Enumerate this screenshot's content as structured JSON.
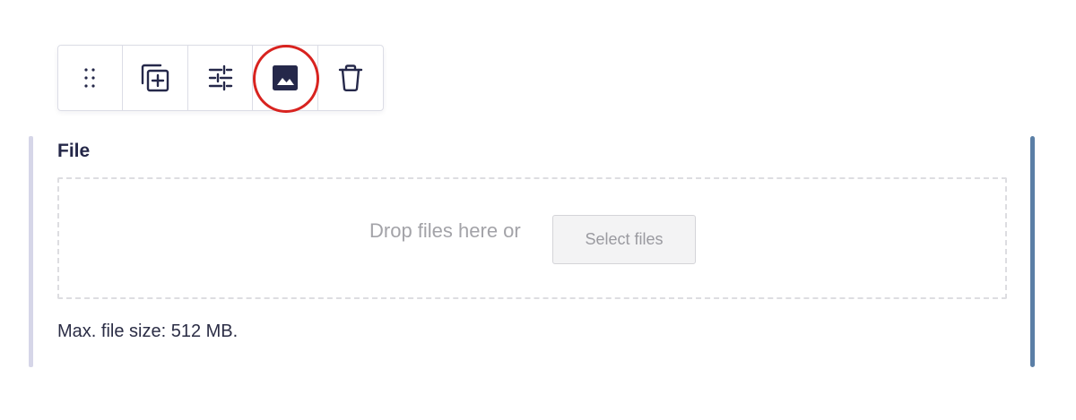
{
  "toolbar": {
    "buttons": [
      {
        "icon": "drag-handle-icon"
      },
      {
        "icon": "duplicate-icon"
      },
      {
        "icon": "settings-sliders-icon"
      },
      {
        "icon": "image-icon",
        "highlighted": true
      },
      {
        "icon": "trash-icon"
      }
    ],
    "highlight_color": "#d8231f"
  },
  "field": {
    "label": "File",
    "dropzone": {
      "text": "Drop files here or",
      "button_label": "Select files"
    },
    "help_text": "Max. file size: 512 MB."
  },
  "colors": {
    "icon": "#25284a",
    "active_bar": "#5b7fa6",
    "inactive_bar": "#d6d6e8"
  }
}
